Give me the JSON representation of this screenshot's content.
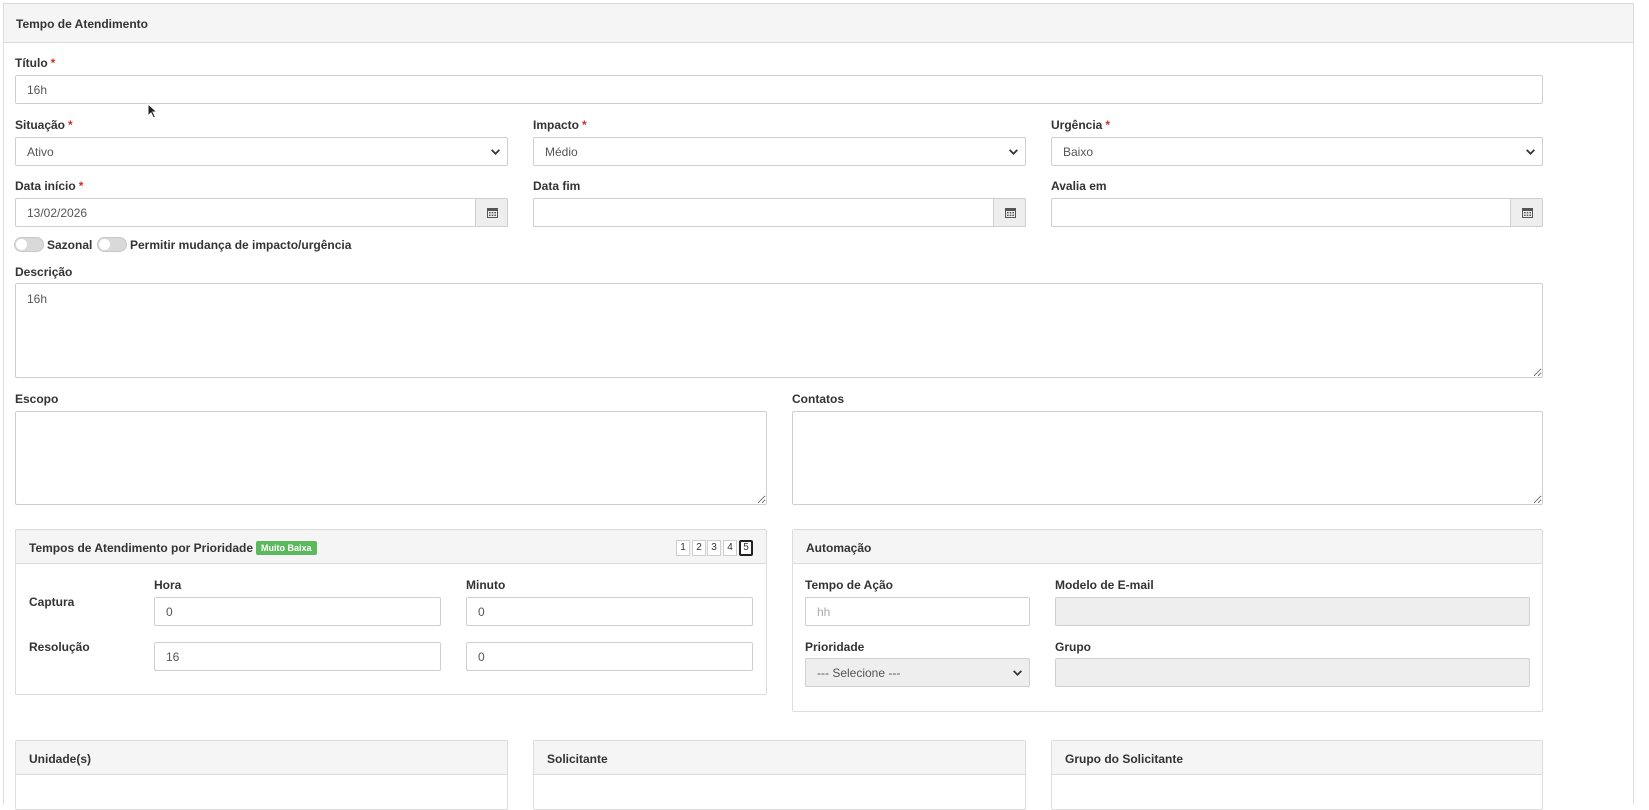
{
  "header": {
    "title": "Tempo de Atendimento"
  },
  "form": {
    "titulo": {
      "label": "Título",
      "value": "16h"
    },
    "situacao": {
      "label": "Situação",
      "value": "Ativo"
    },
    "impacto": {
      "label": "Impacto",
      "value": "Médio"
    },
    "urgencia": {
      "label": "Urgência",
      "value": "Baixo"
    },
    "data_inicio": {
      "label": "Data início",
      "value": "13/02/2026"
    },
    "data_fim": {
      "label": "Data fim",
      "value": ""
    },
    "avalia_em": {
      "label": "Avalia em",
      "value": ""
    },
    "sazonal": {
      "label": "Sazonal"
    },
    "permitir": {
      "label": "Permitir mudança de impacto/urgência"
    },
    "descricao": {
      "label": "Descrição",
      "value": "16h"
    },
    "escopo": {
      "label": "Escopo",
      "value": ""
    },
    "contatos": {
      "label": "Contatos",
      "value": ""
    },
    "required_mark": "*"
  },
  "tempos": {
    "title": "Tempos de Atendimento por Prioridade",
    "badge": "Muito Baixa",
    "badge_color": "#5cb85c",
    "pages": [
      "1",
      "2",
      "3",
      "4",
      "5"
    ],
    "active_page": "5",
    "col_hora": "Hora",
    "col_minuto": "Minuto",
    "captura": {
      "label": "Captura",
      "hora": "0",
      "minuto": "0"
    },
    "resolucao": {
      "label": "Resolução",
      "hora": "16",
      "minuto": "0"
    }
  },
  "automacao": {
    "title": "Automação",
    "tempo_acao": {
      "label": "Tempo de Ação",
      "placeholder": "hh"
    },
    "modelo_email": {
      "label": "Modelo de E-mail",
      "value": ""
    },
    "prioridade": {
      "label": "Prioridade",
      "value": "--- Selecione ---"
    },
    "grupo": {
      "label": "Grupo",
      "value": ""
    }
  },
  "bottom_panels": {
    "unidades": "Unidade(s)",
    "solicitante": "Solicitante",
    "grupo_solicitante": "Grupo do Solicitante"
  }
}
